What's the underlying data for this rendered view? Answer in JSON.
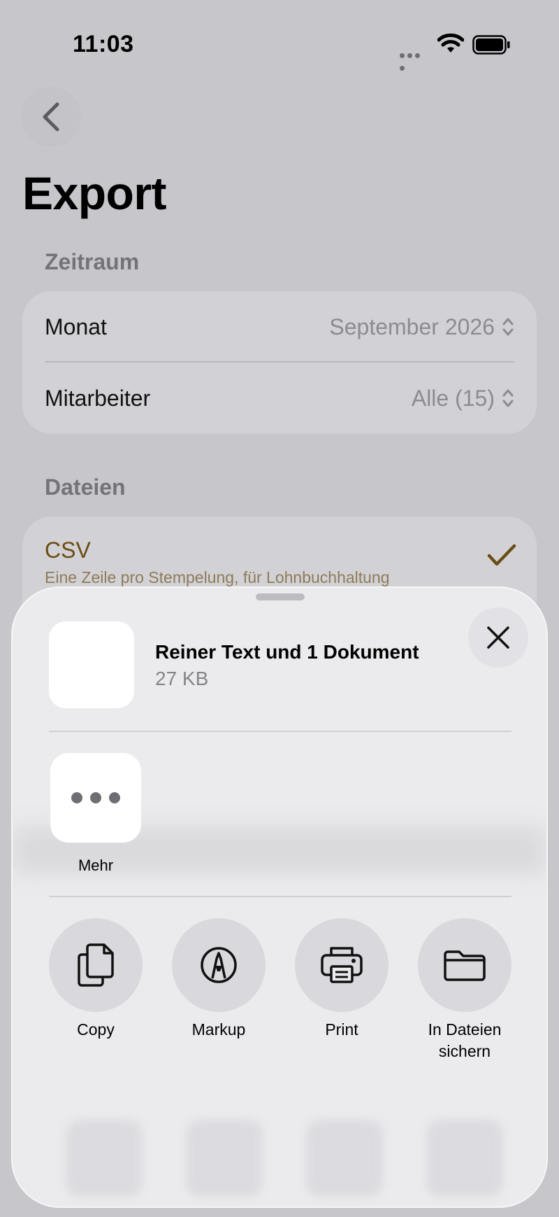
{
  "status_bar": {
    "time": "11:03"
  },
  "nav": {
    "title": "Export"
  },
  "section_period": {
    "label": "Zeitraum",
    "rows": [
      {
        "label": "Monat",
        "value": "September 2026"
      },
      {
        "label": "Mitarbeiter",
        "value": "Alle (15)"
      }
    ]
  },
  "section_files": {
    "label": "Dateien",
    "csv": {
      "title": "CSV",
      "subtitle": "Eine Zeile pro Stempelung, für Lohnbuchhaltung",
      "selected": true
    }
  },
  "share_sheet": {
    "title": "Reiner Text und 1 Dokument",
    "size": "27 KB",
    "more_label": "Mehr",
    "actions": [
      {
        "label": "Copy",
        "icon": "copy-icon"
      },
      {
        "label": "Markup",
        "icon": "markup-icon"
      },
      {
        "label": "Print",
        "icon": "print-icon"
      },
      {
        "label": "In Dateien sichern",
        "icon": "folder-icon"
      }
    ]
  },
  "colors": {
    "accent": "#6b4c13",
    "background": "#c6c6cb",
    "sheet": "#ebebee"
  }
}
